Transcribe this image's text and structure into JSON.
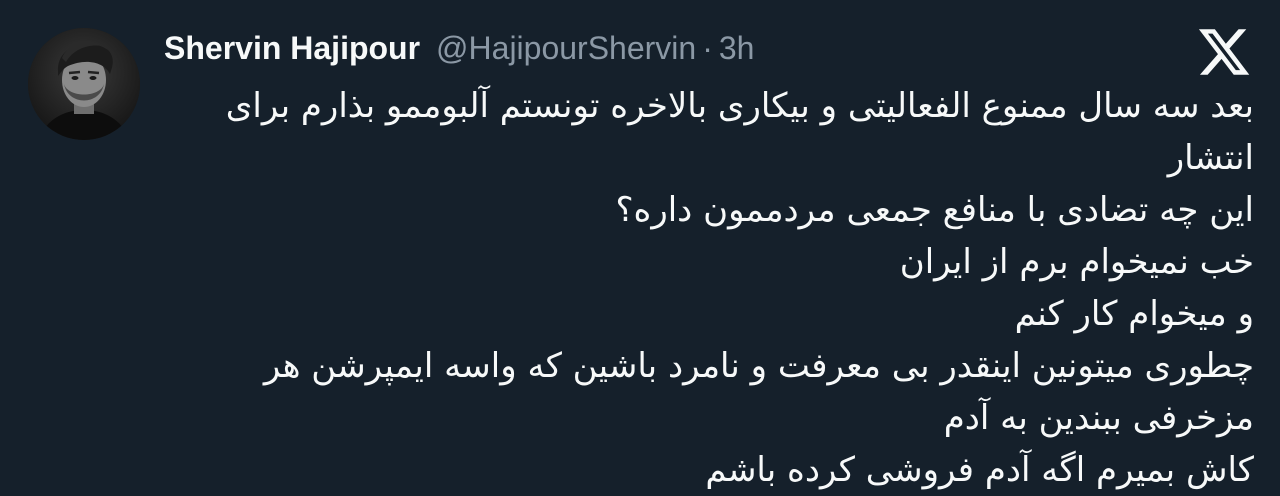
{
  "author": {
    "display_name": "Shervin Hajipour",
    "handle": "@HajipourShervin",
    "separator": "·",
    "time": "3h"
  },
  "icons": {
    "avatar": "profile-photo",
    "platform_logo": "x-logo-icon"
  },
  "tweet": {
    "lines": [
      "بعد سه سال ممنوع الفعالیتی و بیکاری بالاخره تونستم آلبوممو بذارم برای",
      "انتشار",
      "این چه تضادی با منافع جمعی مردممون داره؟",
      "خب نمیخوام برم از ایران",
      "و میخوام کار کنم",
      "چطوری میتونین اینقدر بی معرفت و نامرد باشین که واسه ایمپرشن هر",
      "مزخرفی ببندین به آدم",
      "کاش بمیرم اگه آدم فروشی کرده باشم"
    ]
  },
  "colors": {
    "background": "#15202b",
    "text_primary": "#f7f9f9",
    "text_secondary": "#8b98a5"
  }
}
